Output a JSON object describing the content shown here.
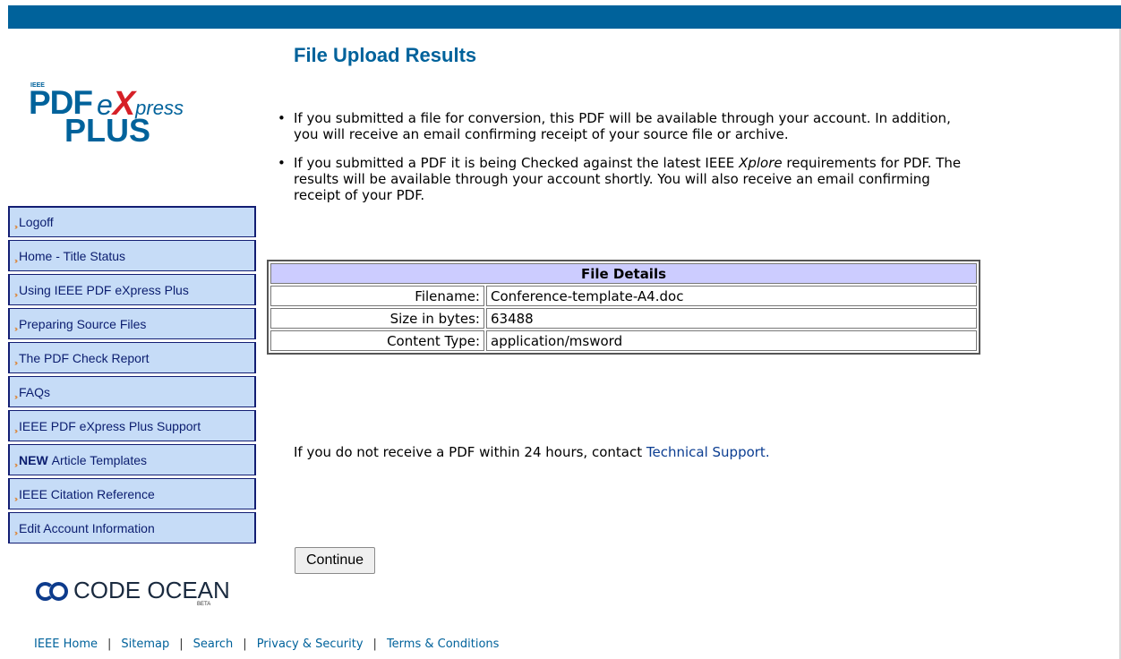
{
  "logo": {
    "ieee": "IEEE",
    "pdf": "PDF",
    "e": "e",
    "x": "X",
    "press": "press",
    "plus": "PLUS"
  },
  "nav": {
    "items": [
      {
        "label": "Logoff"
      },
      {
        "label": "Home - Title Status"
      },
      {
        "label": "Using IEEE PDF eXpress Plus"
      },
      {
        "label": "Preparing Source Files"
      },
      {
        "label": "The PDF Check Report"
      },
      {
        "label": "FAQs"
      },
      {
        "label": "IEEE PDF eXpress Plus Support"
      },
      {
        "badge": "NEW",
        "label": "Article Templates"
      },
      {
        "label": "IEEE Citation Reference"
      },
      {
        "label": "Edit Account Information"
      }
    ],
    "bullet_glyph": "››"
  },
  "code_ocean": {
    "name": "CODE OCEAN",
    "beta": "BETA"
  },
  "footer": {
    "links": [
      "IEEE Home",
      "Sitemap",
      "Search",
      "Privacy & Security",
      "Terms & Conditions"
    ],
    "separator": "|"
  },
  "main": {
    "title": "File Upload Results",
    "bullet1": "If you submitted a file for conversion, this PDF will be available through your account. In addition, you will receive an email confirming receipt of your source file or archive.",
    "bullet2_pre": "If you submitted a PDF it is being Checked against the latest IEEE ",
    "bullet2_italic": "Xplore",
    "bullet2_post": " requirements for PDF. The results will be available through your account shortly. You will also receive an email confirming receipt of your PDF.",
    "details": {
      "header": "File Details",
      "rows": [
        {
          "label": "Filename:",
          "value": "Conference-template-A4.doc"
        },
        {
          "label": "Size in bytes:",
          "value": "63488"
        },
        {
          "label": "Content Type:",
          "value": "application/msword"
        }
      ]
    },
    "notice_text": "If you do not receive a PDF within 24 hours, contact ",
    "notice_link": "Technical Support.",
    "continue_label": "Continue"
  },
  "colors": {
    "brand": "#00629b",
    "nav_bg": "#c6dcf7",
    "nav_border": "#131e73",
    "table_header": "#ccccff",
    "accent_red": "#d62027"
  }
}
